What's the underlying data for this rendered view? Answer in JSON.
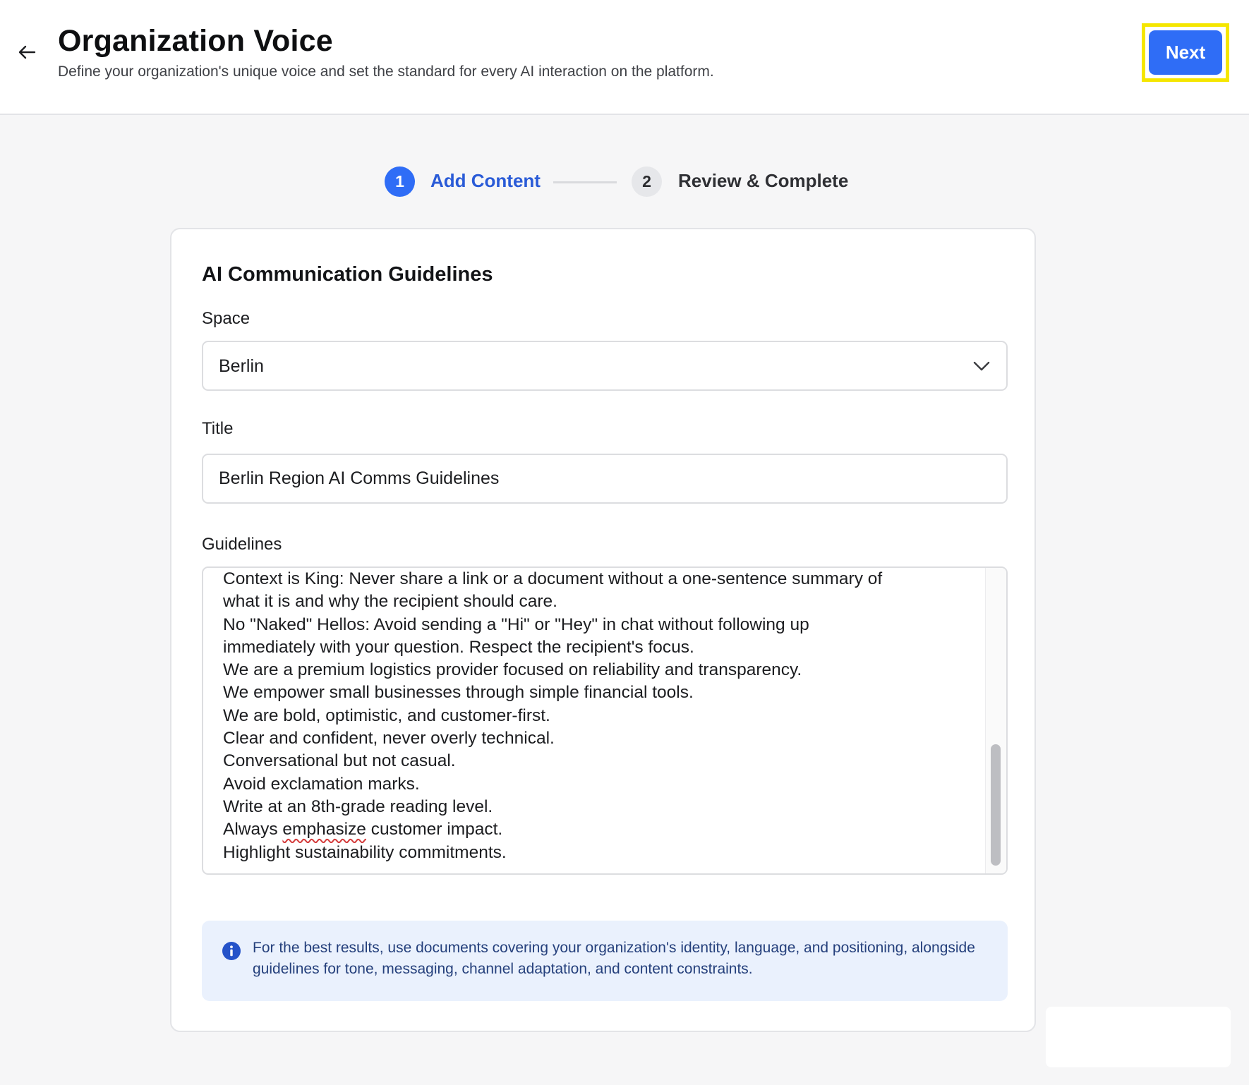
{
  "header": {
    "title": "Organization Voice",
    "subtitle": "Define your organization's unique voice and set the standard for every AI interaction on the platform.",
    "next_label": "Next",
    "back_icon": "arrow-left-icon"
  },
  "stepper": {
    "steps": [
      {
        "number": "1",
        "label": "Add Content",
        "state": "active"
      },
      {
        "number": "2",
        "label": "Review & Complete",
        "state": "pending"
      }
    ]
  },
  "form": {
    "card_title": "AI Communication Guidelines",
    "space": {
      "label": "Space",
      "value": "Berlin",
      "icon": "chevron-down-icon"
    },
    "title": {
      "label": "Title",
      "value": "Berlin Region AI Comms Guidelines"
    },
    "guidelines": {
      "label": "Guidelines",
      "lines": [
        "Context is King: Never share a link or a document without a one-sentence summary of",
        "what it is and why the recipient should care.",
        "No \"Naked\" Hellos: Avoid sending a \"Hi\" or \"Hey\" in chat without following up",
        "immediately with your question. Respect the recipient's focus.",
        "We are a premium logistics provider focused on reliability and transparency.",
        "We empower small businesses through simple financial tools.",
        "We are bold, optimistic, and customer-first.",
        "Clear and confident, never overly technical.",
        "Conversational but not casual.",
        "Avoid exclamation marks.",
        "Write at an 8th-grade reading level.",
        "Highlight sustainability commitments."
      ],
      "emphasis_line": {
        "before": "Always ",
        "misspelled": "emphasize",
        "after": " customer impact."
      }
    },
    "info": {
      "icon": "info-icon",
      "text": "For the best results, use documents covering your organization's identity, language, and positioning, alongside guidelines for tone, messaging, channel adaptation, and content constraints."
    }
  },
  "colors": {
    "accent": "#2f6df6",
    "highlight": "#f5e600",
    "info_bg": "#eaf1fd"
  }
}
